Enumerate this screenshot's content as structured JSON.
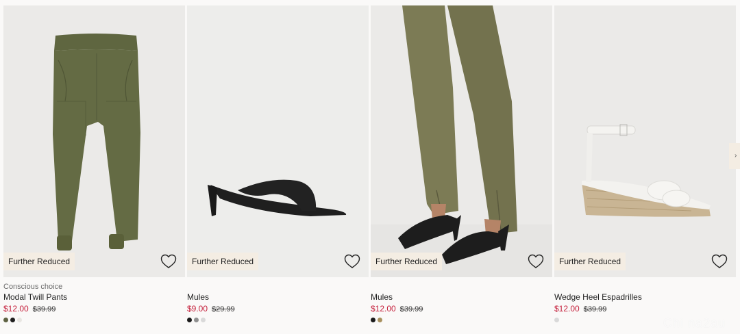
{
  "products": [
    {
      "badge": "Further Reduced",
      "tag": "Conscious choice",
      "name": "Modal Twill Pants",
      "price_sale": "$12.00",
      "price_original": "$39.99",
      "swatches": [
        "#5e6242",
        "#1e1e1e",
        "#e8e6e2"
      ]
    },
    {
      "badge": "Further Reduced",
      "tag": "",
      "name": "Mules",
      "price_sale": "$9.00",
      "price_original": "$29.99",
      "swatches": [
        "#1a1a1a",
        "#8f8f8f",
        "#d9d9d9"
      ]
    },
    {
      "badge": "Further Reduced",
      "tag": "",
      "name": "Mules",
      "price_sale": "$12.00",
      "price_original": "$39.99",
      "swatches": [
        "#1a1a1a",
        "#a8905e"
      ]
    },
    {
      "badge": "Further Reduced",
      "tag": "",
      "name": "Wedge Heel Espadrilles",
      "price_sale": "$12.00",
      "price_original": "$39.99",
      "swatches": [
        "#d9d9d9"
      ]
    }
  ],
  "icons": {
    "favorite": "heart-outline-icon",
    "next": "chevron-right-icon"
  },
  "colors": {
    "sale_price": "#c41e3a",
    "badge_bg": "#f4ede3"
  },
  "watermark": "Chi na2au"
}
